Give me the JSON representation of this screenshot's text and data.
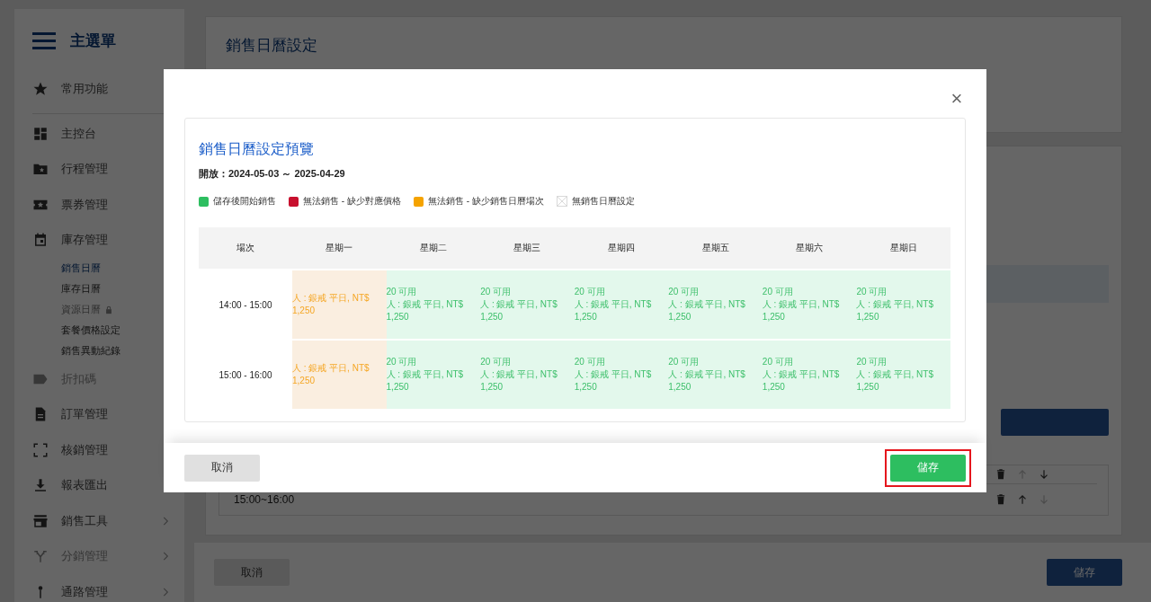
{
  "sidebar": {
    "title": "主選單",
    "items": [
      {
        "kind": "star",
        "label": "常用功能",
        "disabled": false,
        "divider_after": true
      },
      {
        "kind": "dashboard",
        "label": "主控台",
        "disabled": false
      },
      {
        "kind": "folder",
        "label": "行程管理",
        "disabled": false
      },
      {
        "kind": "ticket",
        "label": "票券管理",
        "disabled": false
      },
      {
        "kind": "calendar",
        "label": "庫存管理",
        "disabled": false,
        "children": [
          {
            "label": "銷售日曆",
            "selected": true,
            "locked": false
          },
          {
            "label": "庫存日曆",
            "selected": false,
            "locked": false
          },
          {
            "label": "資源日曆",
            "selected": false,
            "locked": true
          },
          {
            "label": "套餐價格設定",
            "selected": false,
            "locked": false
          },
          {
            "label": "銷售異動紀錄",
            "selected": false,
            "locked": false
          }
        ]
      },
      {
        "kind": "tag",
        "label": "折扣碼",
        "disabled": true
      },
      {
        "kind": "document",
        "label": "訂單管理",
        "disabled": false
      },
      {
        "kind": "scan",
        "label": "核銷管理",
        "disabled": false
      },
      {
        "kind": "download",
        "label": "報表匯出",
        "disabled": false
      },
      {
        "kind": "store",
        "label": "銷售工具",
        "disabled": false,
        "chevron": true
      },
      {
        "kind": "fork",
        "label": "分銷管理",
        "disabled": true,
        "chevron": true
      },
      {
        "kind": "pin",
        "label": "通路管理",
        "disabled": false,
        "chevron": true
      }
    ]
  },
  "page": {
    "title": "銷售日曆設定",
    "sessions": [
      "15:00~16:00"
    ],
    "footer": {
      "cancel": "取消",
      "save": "儲存"
    }
  },
  "dialog": {
    "close": "×",
    "title": "銷售日曆設定預覽",
    "period": "開放：2024-05-03 ～ 2025-04-29",
    "legend": [
      {
        "kind": "swatch",
        "color": "#2dbe60",
        "label": "儲存後開始銷售"
      },
      {
        "kind": "swatch",
        "color": "#c8102e",
        "label": "無法銷售 - 缺少對應價格"
      },
      {
        "kind": "swatch",
        "color": "#f5a300",
        "label": "無法銷售 - 缺少銷售日曆場次"
      },
      {
        "kind": "crossed",
        "label": "無銷售日曆設定"
      }
    ],
    "session_header": "場次",
    "columns": [
      "星期一",
      "星期二",
      "星期三",
      "星期四",
      "星期五",
      "星期六",
      "星期日"
    ],
    "rows": [
      {
        "session": "14:00 - 15:00",
        "cells": [
          {
            "kind": "missing_session",
            "price": "人 : 銀戒 平日, NT$ 1,250"
          },
          {
            "kind": "on_sale",
            "available": "20 可用",
            "price": "人 : 銀戒 平日, NT$ 1,250"
          },
          {
            "kind": "on_sale",
            "available": "20 可用",
            "price": "人 : 銀戒 平日, NT$ 1,250"
          },
          {
            "kind": "on_sale",
            "available": "20 可用",
            "price": "人 : 銀戒 平日, NT$ 1,250"
          },
          {
            "kind": "on_sale",
            "available": "20 可用",
            "price": "人 : 銀戒 平日, NT$ 1,250"
          },
          {
            "kind": "on_sale",
            "available": "20 可用",
            "price": "人 : 銀戒 平日, NT$ 1,250"
          },
          {
            "kind": "on_sale",
            "available": "20 可用",
            "price": "人 : 銀戒 平日, NT$ 1,250"
          }
        ]
      },
      {
        "session": "15:00 - 16:00",
        "cells": [
          {
            "kind": "missing_session",
            "price": "人 : 銀戒 平日, NT$ 1,250"
          },
          {
            "kind": "on_sale",
            "available": "20 可用",
            "price": "人 : 銀戒 平日, NT$ 1,250"
          },
          {
            "kind": "on_sale",
            "available": "20 可用",
            "price": "人 : 銀戒 平日, NT$ 1,250"
          },
          {
            "kind": "on_sale",
            "available": "20 可用",
            "price": "人 : 銀戒 平日, NT$ 1,250"
          },
          {
            "kind": "on_sale",
            "available": "20 可用",
            "price": "人 : 銀戒 平日, NT$ 1,250"
          },
          {
            "kind": "on_sale",
            "available": "20 可用",
            "price": "人 : 銀戒 平日, NT$ 1,250"
          },
          {
            "kind": "on_sale",
            "available": "20 可用",
            "price": "人 : 銀戒 平日, NT$ 1,250"
          }
        ]
      }
    ],
    "cancel": "取消",
    "save": "儲存",
    "save_highlighted": true
  }
}
